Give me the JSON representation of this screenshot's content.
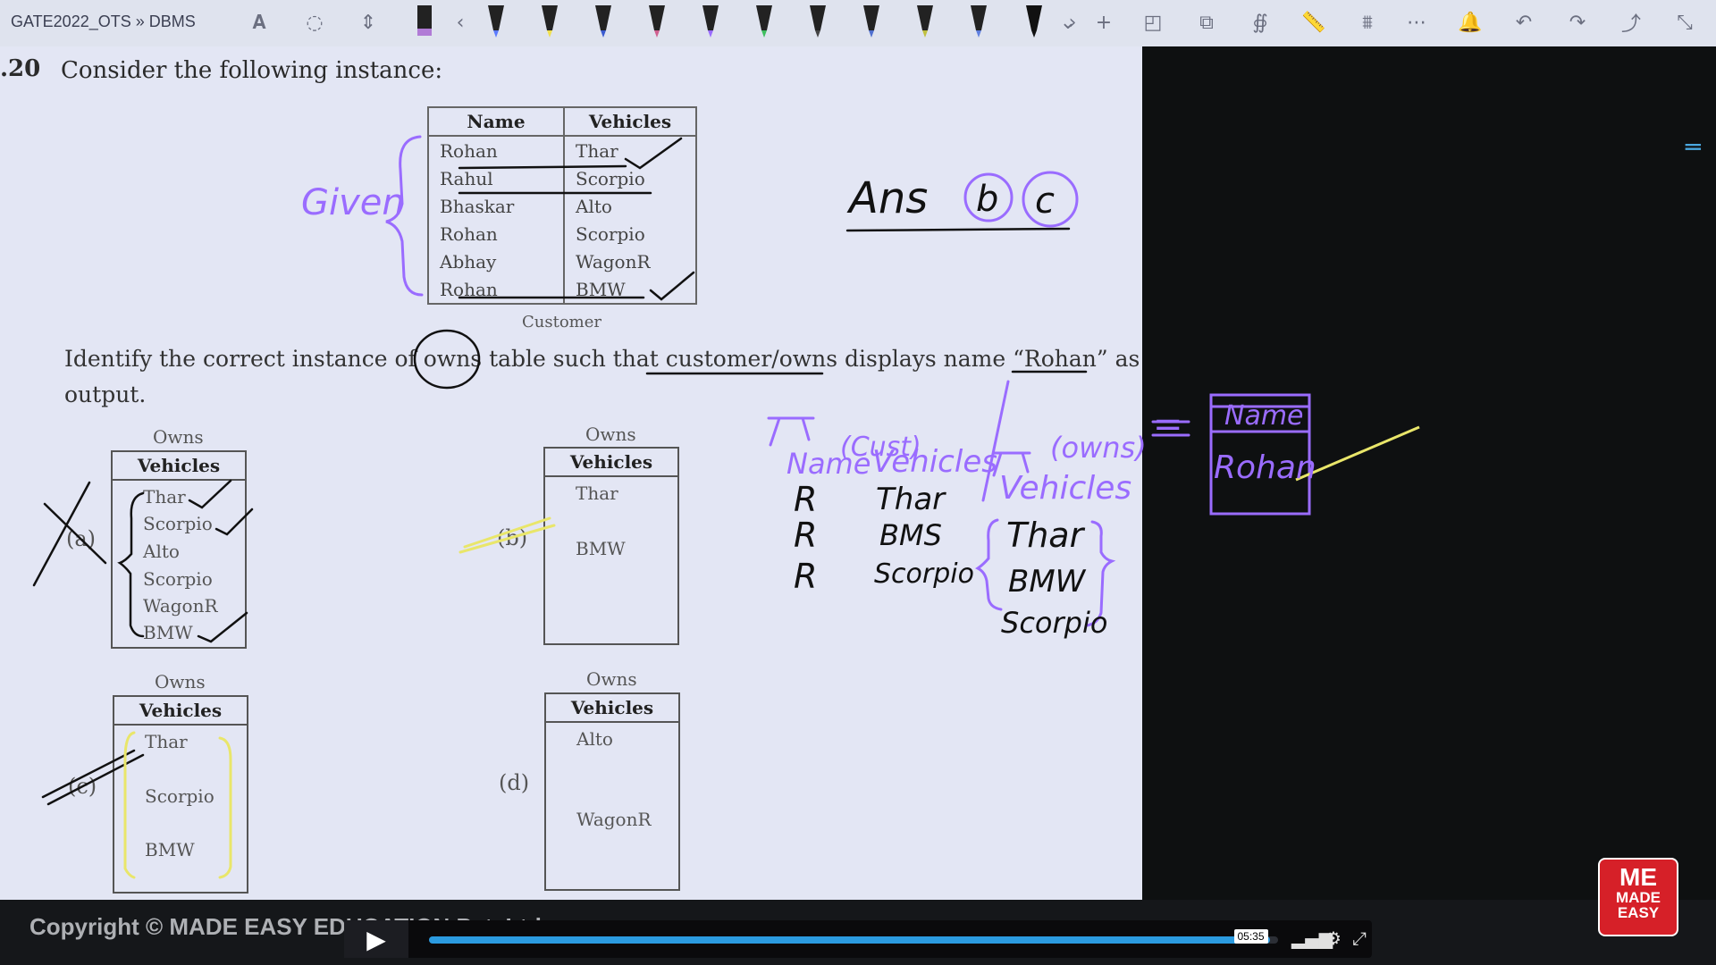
{
  "toolbar": {
    "breadcrumb": "GATE2022_OTS » DBMS",
    "icons": [
      "text-select-icon",
      "lasso-icon",
      "insert-space-icon",
      "highlighter-icon",
      "pen-icon",
      "shapes-icon",
      "ruler-icon",
      "more-icon",
      "bell-icon",
      "undo-icon",
      "redo-icon",
      "share-icon",
      "collapse-icon"
    ]
  },
  "question": {
    "number": ".20",
    "prompt": "Consider the following instance:",
    "identify_line1": "Identify the correct instance of owns table such that customer/owns displays name “Rohan” as",
    "identify_line2": "output.",
    "customer": {
      "caption": "Customer",
      "headers": [
        "Name",
        "Vehicles"
      ],
      "rows": [
        [
          "Rohan",
          "Thar"
        ],
        [
          "Rahul",
          "Scorpio"
        ],
        [
          "Bhaskar",
          "Alto"
        ],
        [
          "Rohan",
          "Scorpio"
        ],
        [
          "Abhay",
          "WagonR"
        ],
        [
          "Rohan",
          "BMW"
        ]
      ]
    },
    "options": {
      "a": {
        "title": "Owns",
        "header": "Vehicles",
        "label": "(a)",
        "values": [
          "Thar",
          "Scorpio",
          "Alto",
          "Scorpio",
          "WagonR",
          "BMW"
        ]
      },
      "b": {
        "title": "Owns",
        "header": "Vehicles",
        "label": "(b)",
        "values": [
          "Thar",
          "BMW"
        ]
      },
      "c": {
        "title": "Owns",
        "header": "Vehicles",
        "label": "(c)",
        "values": [
          "Thar",
          "Scorpio",
          "BMW"
        ]
      },
      "d": {
        "title": "Owns",
        "header": "Vehicles",
        "label": "(d)",
        "values": [
          "Alto",
          "WagonR"
        ]
      }
    }
  },
  "annotations": {
    "given": "Given",
    "answer": "Ans",
    "answer_b": "b",
    "answer_c": "c",
    "cust": "(Cust)",
    "owns": "(owns)",
    "name_col": "Name",
    "vehicles_col": "Vehicles",
    "vehicles2": "Vehicles",
    "rows": [
      [
        "R",
        "Thar"
      ],
      [
        "R",
        "BMS"
      ],
      [
        "R",
        "Scorpio"
      ]
    ],
    "owns_vals": [
      "Thar",
      "BMW",
      "Scorpio"
    ],
    "result_header": "Name",
    "result_value": "Rohan",
    "equals": "="
  },
  "footer": {
    "copyright": "Copyright © MADE EASY EDUCATION Pvt. Ltd.",
    "time": "05:35",
    "progress": 0.99,
    "logo_top": "ME",
    "logo_line1": "MADE",
    "logo_line2": "EASY"
  },
  "colors": {
    "ink_purple": "#9a6cff",
    "ink_black": "#111111",
    "highlight_yellow": "#e9e66a",
    "accent_blue": "#2b9be0"
  }
}
